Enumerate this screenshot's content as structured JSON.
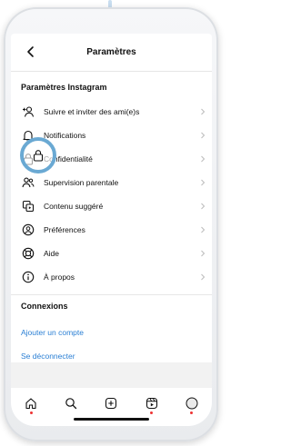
{
  "header": {
    "title": "Paramètres"
  },
  "section_instagram": {
    "title": "Paramètres Instagram",
    "items": [
      {
        "label": "Suivre et inviter des ami(e)s",
        "icon": "add-person-icon"
      },
      {
        "label": "Notifications",
        "icon": "bell-icon"
      },
      {
        "label": "Confidentialité",
        "icon": "lock-icon"
      },
      {
        "label": "Supervision parentale",
        "icon": "people-icon"
      },
      {
        "label": "Contenu suggéré",
        "icon": "suggested-content-icon"
      },
      {
        "label": "Préférences",
        "icon": "preferences-icon"
      },
      {
        "label": "Aide",
        "icon": "lifebuoy-icon"
      },
      {
        "label": "À propos",
        "icon": "info-icon"
      }
    ]
  },
  "section_connexions": {
    "title": "Connexions",
    "add_account": "Ajouter un compte",
    "logout": "Se déconnecter"
  },
  "colors": {
    "link": "#2a7fd4",
    "highlight": "#6aa9d3",
    "notification_dot": "#e33"
  },
  "tabbar": [
    "home-icon",
    "search-icon",
    "create-icon",
    "reels-icon",
    "profile-icon"
  ]
}
